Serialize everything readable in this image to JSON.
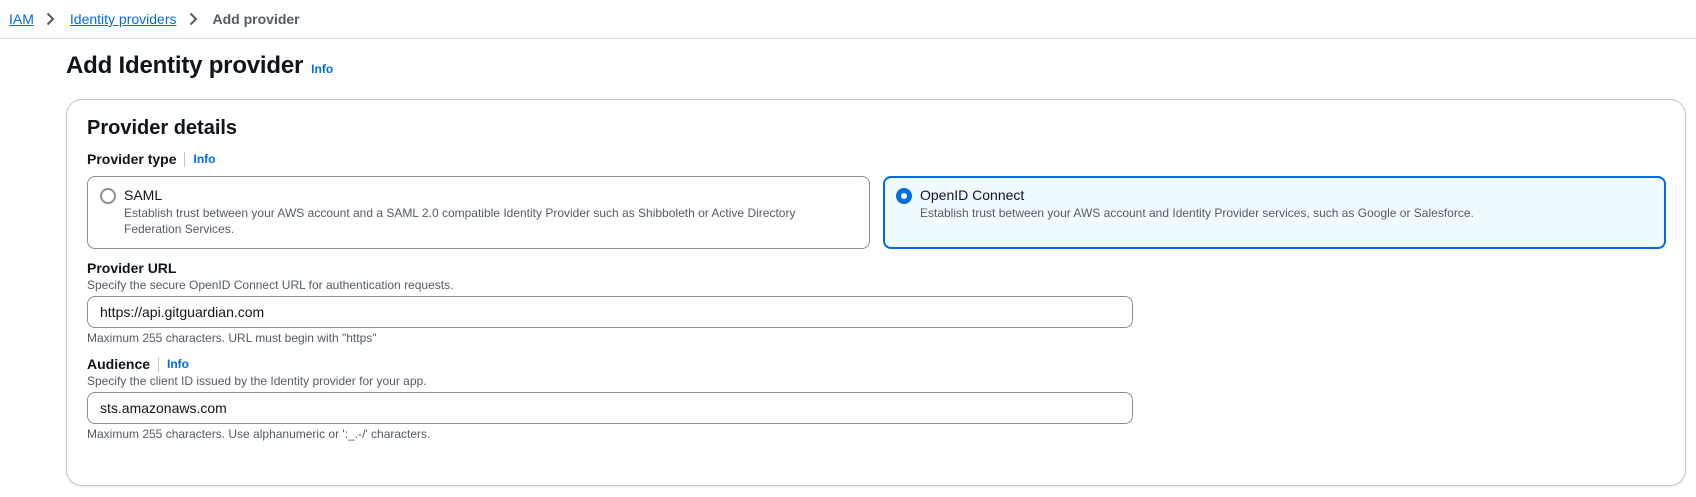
{
  "breadcrumb": {
    "items": [
      {
        "label": "IAM"
      },
      {
        "label": "Identity providers"
      },
      {
        "label": "Add provider"
      }
    ]
  },
  "header": {
    "title": "Add Identity provider",
    "info": "Info"
  },
  "panel": {
    "title": "Provider details",
    "provider_type": {
      "label": "Provider type",
      "info": "Info",
      "selected": "OpenID Connect",
      "options": [
        {
          "title": "SAML",
          "description": "Establish trust between your AWS account and a SAML 2.0 compatible Identity Provider such as Shibboleth or Active Directory Federation Services."
        },
        {
          "title": "OpenID Connect",
          "description": "Establish trust between your AWS account and Identity Provider services, such as Google or Salesforce."
        }
      ]
    },
    "provider_url": {
      "label": "Provider URL",
      "description": "Specify the secure OpenID Connect URL for authentication requests.",
      "value": "https://api.gitguardian.com",
      "constraint": "Maximum 255 characters. URL must begin with \"https\""
    },
    "audience": {
      "label": "Audience",
      "info": "Info",
      "description": "Specify the client ID issued by the Identity provider for your app.",
      "value": "sts.amazonaws.com",
      "constraint": "Maximum 255 characters. Use alphanumeric or ':_.-/' characters."
    }
  },
  "colors": {
    "link": "#006ce0",
    "selected_border": "#006ce0",
    "selected_background": "#f0fbff"
  }
}
